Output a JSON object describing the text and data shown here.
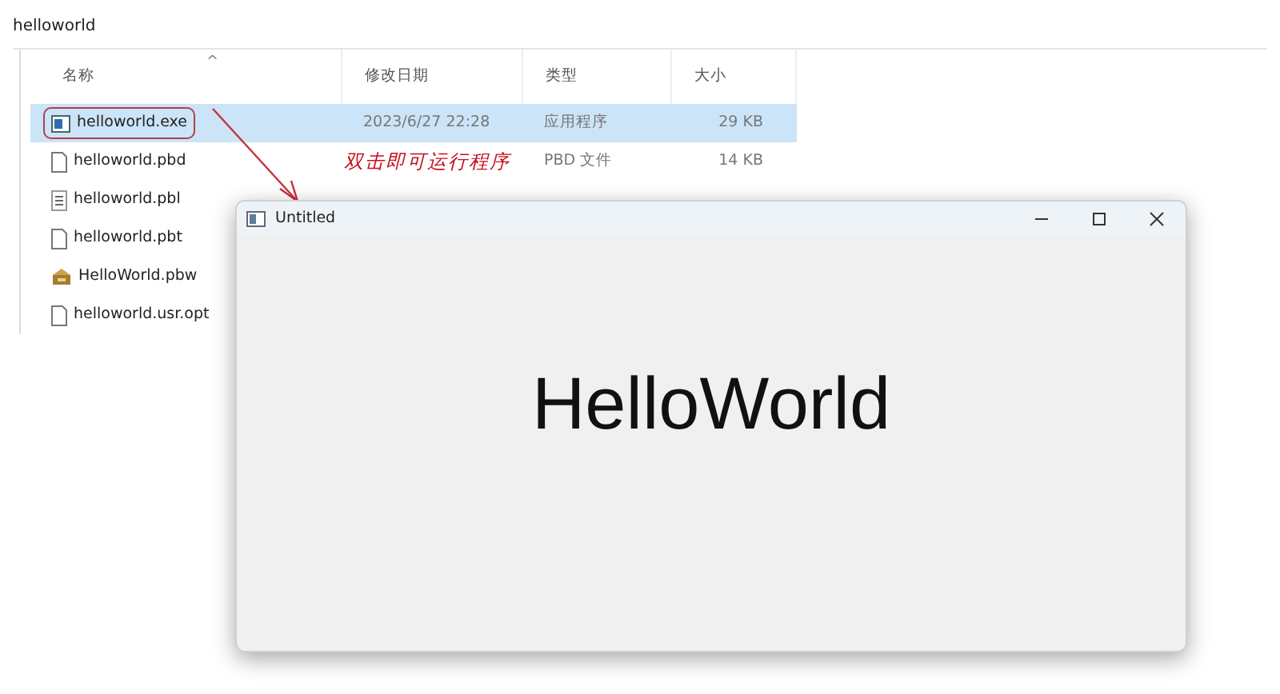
{
  "folder_title": "helloworld",
  "columns": [
    {
      "label": "名称",
      "sort_indicator": "^"
    },
    {
      "label": "修改日期"
    },
    {
      "label": "类型"
    },
    {
      "label": "大小"
    }
  ],
  "rows": [
    {
      "name": "helloworld.exe",
      "kind": "exe",
      "selected": true,
      "highlighted": true,
      "date": "2023/6/27 22:28",
      "type": "应用程序",
      "size": "29 KB"
    },
    {
      "name": "helloworld.pbd",
      "kind": "file",
      "selected": false,
      "highlighted": false,
      "type": "PBD 文件",
      "size": "14 KB"
    },
    {
      "name": "helloworld.pbl",
      "kind": "lines",
      "selected": false,
      "highlighted": false
    },
    {
      "name": "helloworld.pbt",
      "kind": "file",
      "selected": false,
      "highlighted": false
    },
    {
      "name": "HelloWorld.pbw",
      "kind": "workspace",
      "selected": false,
      "highlighted": false
    },
    {
      "name": "helloworld.usr.opt",
      "kind": "file",
      "selected": false,
      "highlighted": false
    }
  ],
  "annotation": {
    "text": "双击即可运行程序"
  },
  "app_window": {
    "title": "Untitled",
    "content": "HelloWorld",
    "controls": [
      {
        "kind": "minimize"
      },
      {
        "kind": "maximize"
      },
      {
        "kind": "close"
      }
    ]
  }
}
